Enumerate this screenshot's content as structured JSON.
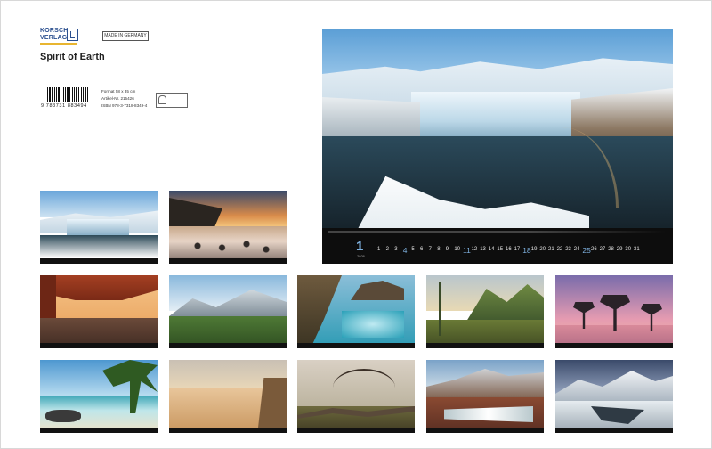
{
  "brand": {
    "line1": "KORSCH",
    "line2": "VERLAG"
  },
  "made_in": "MADE IN GERMANY",
  "title": "Spirit of Earth",
  "barcode_number": "9 783731 883494",
  "specs": {
    "format": "Format 58 x 35 cm",
    "article": "Artikel-Nr. 215426",
    "isbn": "ISBN 978-3-7318-8349-4"
  },
  "calendar": {
    "month": "1",
    "year": "2026",
    "days": [
      "1",
      "2",
      "3",
      "4",
      "5",
      "6",
      "7",
      "8",
      "9",
      "10",
      "11",
      "12",
      "13",
      "14",
      "15",
      "16",
      "17",
      "18",
      "19",
      "20",
      "21",
      "22",
      "23",
      "24",
      "25",
      "26",
      "27",
      "28",
      "29",
      "30",
      "31"
    ]
  },
  "colors": {
    "accent": "#7fb2e0",
    "brand_blue": "#2a4f8f",
    "brand_yellow": "#e8b530"
  }
}
